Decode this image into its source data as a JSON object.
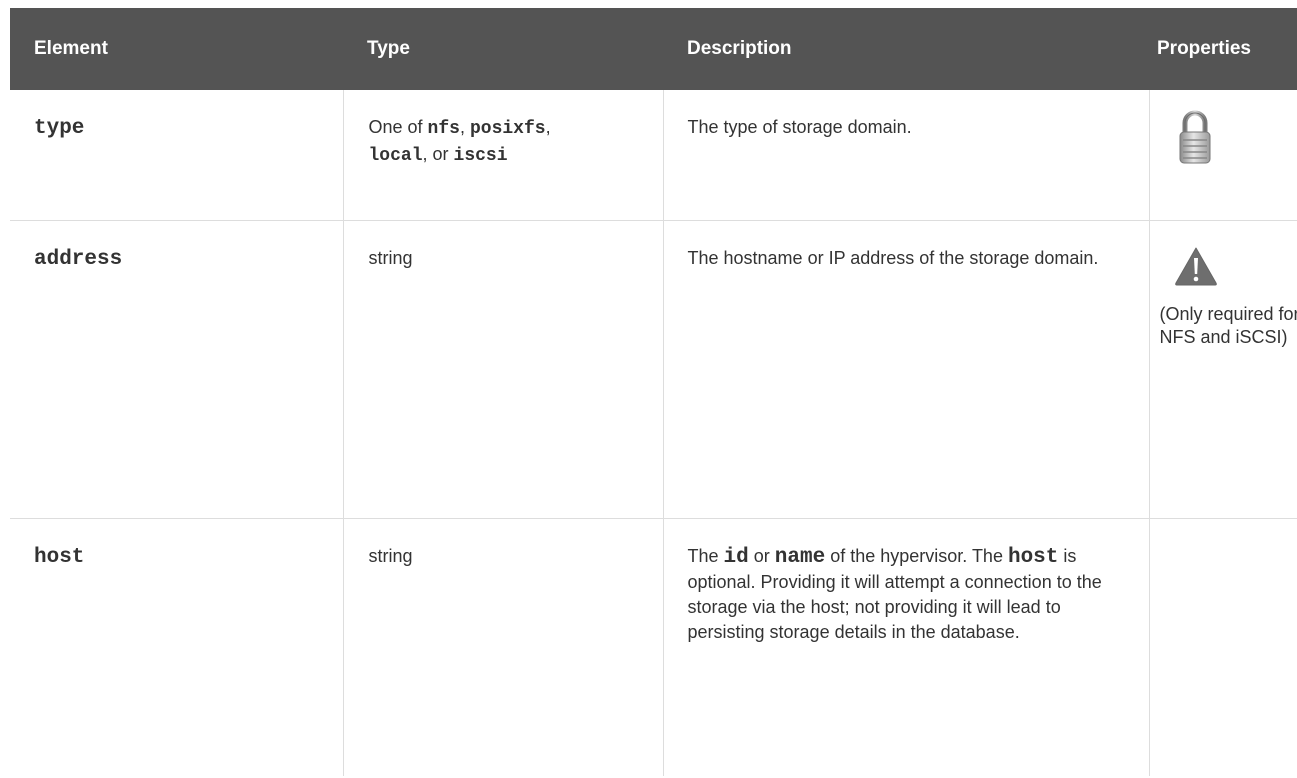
{
  "table": {
    "headers": {
      "element": "Element",
      "type": "Type",
      "description": "Description",
      "properties": "Properties"
    },
    "rows": [
      {
        "element": "type",
        "type": {
          "prefix": "One of ",
          "v1": "nfs",
          "sep1": ", ",
          "v2": "posixfs",
          "sep2": ",",
          "v3": "local",
          "sep3": ", or ",
          "v4": "iscsi"
        },
        "description": "The type of storage domain.",
        "properties": {
          "icon": "lock-icon"
        }
      },
      {
        "element": "address",
        "type": "string",
        "description": "The hostname or IP address of the storage domain.",
        "properties": {
          "icon": "warning-icon",
          "note": "(Only required for NFS and iSCSI)"
        }
      },
      {
        "element": "host",
        "type": "string",
        "description": {
          "t1": "The ",
          "c1": "id",
          "t2": " or ",
          "c2": "name",
          "t3": " of the hypervisor. The ",
          "c3": "host",
          "t4": " is optional. Providing it will attempt a connection to the storage via the host; not providing it will lead to persisting storage details in the database."
        },
        "properties": {}
      }
    ]
  },
  "colors": {
    "header_bg": "#545454",
    "header_text": "#ffffff",
    "body_text": "#333333",
    "grid_line": "#dddddd",
    "icon_gray": "#6e6e6e"
  }
}
